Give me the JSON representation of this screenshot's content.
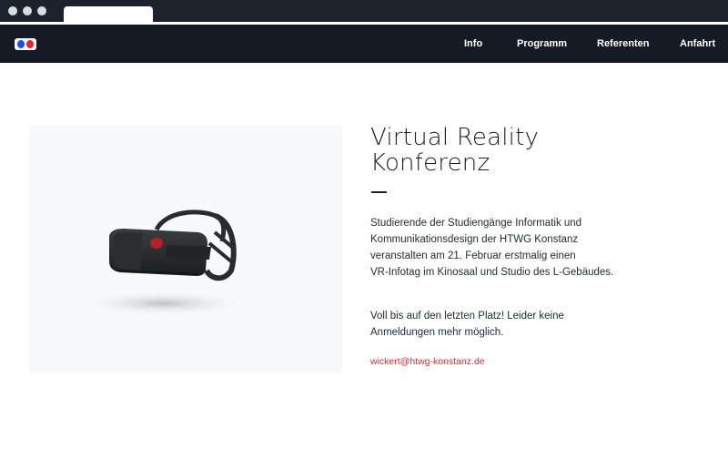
{
  "nav": {
    "items": [
      {
        "label": "Info"
      },
      {
        "label": "Programm"
      },
      {
        "label": "Referenten"
      },
      {
        "label": "Anfahrt"
      }
    ]
  },
  "hero": {
    "title_line1": "Virtual Reality",
    "title_line2": "Konferenz",
    "description": [
      "Studierende der Studiengänge Informatik und",
      "Kommunikationsdesign der HTWG Konstanz",
      "veranstalten am 21. Februar erstmalig einen",
      "VR-Infotag im Kinosaal und Studio des L-Gebäudes."
    ],
    "note": [
      "Voll bis auf den letzten Platz! Leider keine",
      "Anmeldungen mehr möglich."
    ],
    "email": "wickert@htwg-konstanz.de"
  },
  "colors": {
    "navbar": "#151b24",
    "accent": "#e3262d",
    "logo_blue": "#1b4fe6",
    "logo_red": "#e8232a"
  },
  "icons": {
    "logo": "vr-glasses-logo-icon",
    "hero_image": "vr-headset-image"
  }
}
